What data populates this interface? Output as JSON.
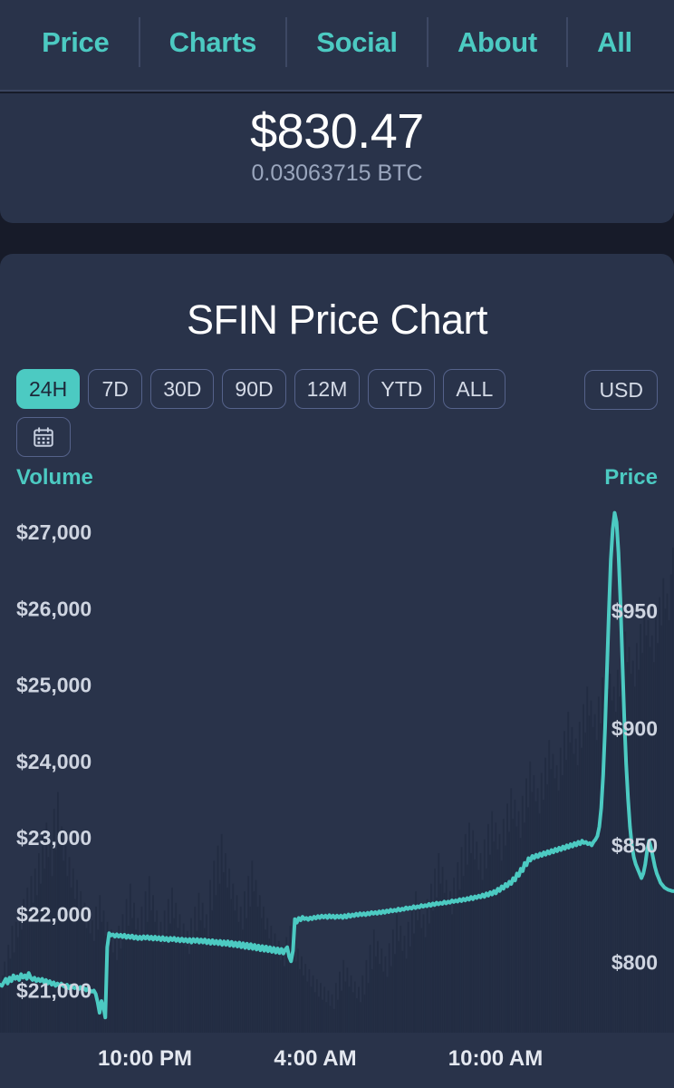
{
  "nav": {
    "items": [
      {
        "label": "Price"
      },
      {
        "label": "Charts"
      },
      {
        "label": "Social"
      },
      {
        "label": "About"
      },
      {
        "label": "All"
      }
    ],
    "accent_color": "#4ccac2"
  },
  "price_header": {
    "price": "$830.47",
    "btc_value": "0.03063715 BTC"
  },
  "chart_card": {
    "title": "SFIN Price Chart",
    "ranges": [
      {
        "label": "24H",
        "active": true
      },
      {
        "label": "7D",
        "active": false
      },
      {
        "label": "30D",
        "active": false
      },
      {
        "label": "90D",
        "active": false
      },
      {
        "label": "12M",
        "active": false
      },
      {
        "label": "YTD",
        "active": false
      },
      {
        "label": "ALL",
        "active": false
      }
    ],
    "calendar_icon": "calendar-icon",
    "currency": "USD",
    "left_axis_title": "Volume",
    "right_axis_title": "Price"
  },
  "chart_data": {
    "type": "line",
    "title": "SFIN Price Chart",
    "xlabel": "",
    "ylabel": "Price",
    "grid": false,
    "legend": "none",
    "line_color": "#4ccac2",
    "volume_color": "#222c42",
    "background_color": "#29334a",
    "x_tick_labels": [
      "10:00 PM",
      "4:00 AM",
      "10:00 AM"
    ],
    "x_tick_positions": [
      0.215,
      0.468,
      0.735
    ],
    "left_axis": {
      "name": "Volume",
      "tick_labels": [
        "$27,000",
        "$26,000",
        "$25,000",
        "$24,000",
        "$23,000",
        "$22,000",
        "$21,000"
      ],
      "tick_values": [
        27000,
        26000,
        25000,
        24000,
        23000,
        22000,
        21000
      ],
      "range": [
        20450,
        27500
      ]
    },
    "right_axis": {
      "name": "Price",
      "tick_labels": [
        "$950",
        "$900",
        "$850",
        "$800"
      ],
      "tick_values": [
        950,
        900,
        850,
        800
      ],
      "range": [
        770,
        1000
      ]
    },
    "series": [
      {
        "name": "Price",
        "axis": "right",
        "unit": "USD",
        "values": [
          790.5,
          790.0,
          791.5,
          793.0,
          791.0,
          793.5,
          792.0,
          794.5,
          793.0,
          794.0,
          792.5,
          795.0,
          793.5,
          794.5,
          793.0,
          795.5,
          793.5,
          792.5,
          793.5,
          792.0,
          793.0,
          792.0,
          793.0,
          791.5,
          792.5,
          791.0,
          792.0,
          790.5,
          791.5,
          790.0,
          791.0,
          790.0,
          791.0,
          790.0,
          789.5,
          790.5,
          789.0,
          790.0,
          789.5,
          789.0,
          789.5,
          788.5,
          789.5,
          788.5,
          789.0,
          788.0,
          789.0,
          788.0,
          787.5,
          788.0,
          786.5,
          783.0,
          778.5,
          783.5,
          781.0,
          776.5,
          806.5,
          812.5,
          811.5,
          812.0,
          811.0,
          812.0,
          811.0,
          811.8,
          810.8,
          811.8,
          810.5,
          811.5,
          810.5,
          811.5,
          810.2,
          811.2,
          810.0,
          811.0,
          810.0,
          811.2,
          810.2,
          811.2,
          810.0,
          811.0,
          809.8,
          811.0,
          809.8,
          810.8,
          809.5,
          810.8,
          809.5,
          810.5,
          809.2,
          810.5,
          809.5,
          810.5,
          809.2,
          810.2,
          809.0,
          810.2,
          809.0,
          810.0,
          808.8,
          810.0,
          808.5,
          810.0,
          808.8,
          810.0,
          808.5,
          809.8,
          808.5,
          809.8,
          808.2,
          809.5,
          808.0,
          809.5,
          808.0,
          809.2,
          807.8,
          809.2,
          807.5,
          809.0,
          807.5,
          809.0,
          807.2,
          808.8,
          807.0,
          808.5,
          806.8,
          808.5,
          806.5,
          808.2,
          806.2,
          808.0,
          806.0,
          807.8,
          805.8,
          807.5,
          805.5,
          807.2,
          805.2,
          807.0,
          805.0,
          806.8,
          804.8,
          806.5,
          804.5,
          806.2,
          804.2,
          806.0,
          804.0,
          805.8,
          803.8,
          805.5,
          806.5,
          802.5,
          800.5,
          805.0,
          818.5,
          817.0,
          819.0,
          818.0,
          819.5,
          818.5,
          819.0,
          818.2,
          819.2,
          818.5,
          819.5,
          818.8,
          819.8,
          819.0,
          820.0,
          819.2,
          820.0,
          819.0,
          820.2,
          819.2,
          820.0,
          819.0,
          820.0,
          819.2,
          820.0,
          819.0,
          820.2,
          819.2,
          820.5,
          819.5,
          820.5,
          819.8,
          820.8,
          820.0,
          821.0,
          820.2,
          821.0,
          820.2,
          821.2,
          820.5,
          821.5,
          820.8,
          821.5,
          820.8,
          821.8,
          821.0,
          822.0,
          821.2,
          822.2,
          821.5,
          822.5,
          821.8,
          822.5,
          822.0,
          823.0,
          822.2,
          823.0,
          822.5,
          823.5,
          822.8,
          823.5,
          823.0,
          824.0,
          823.2,
          824.0,
          823.5,
          824.5,
          823.8,
          824.5,
          824.0,
          825.0,
          824.2,
          825.2,
          824.5,
          825.5,
          824.8,
          825.5,
          825.0,
          826.0,
          825.2,
          826.0,
          825.5,
          826.5,
          825.8,
          826.5,
          826.0,
          827.0,
          826.2,
          827.2,
          826.5,
          827.5,
          826.8,
          828.0,
          827.0,
          828.2,
          827.5,
          828.5,
          827.8,
          829.0,
          828.0,
          829.5,
          828.5,
          830.0,
          829.0,
          830.5,
          829.5,
          831.5,
          830.5,
          832.5,
          831.5,
          833.5,
          832.5,
          834.5,
          833.5,
          836.0,
          835.0,
          838.0,
          837.0,
          840.0,
          839.0,
          842.5,
          841.5,
          844.5,
          843.5,
          845.5,
          844.5,
          846.0,
          845.0,
          846.5,
          845.5,
          847.0,
          846.0,
          847.5,
          846.5,
          848.0,
          847.0,
          848.5,
          847.5,
          849.0,
          848.0,
          849.5,
          848.5,
          850.0,
          849.0,
          850.5,
          849.5,
          851.0,
          850.0,
          851.5,
          850.5,
          852.0,
          851.0,
          851.5,
          850.5,
          851.0,
          850.0,
          851.5,
          852.5,
          854.0,
          858.0,
          866.0,
          880.0,
          900.0,
          925.0,
          950.0,
          972.0,
          985.0,
          992.0,
          988.0,
          975.0,
          955.0,
          930.0,
          905.0,
          885.0,
          870.0,
          858.0,
          850.0,
          845.0,
          842.0,
          840.0,
          838.0,
          836.0,
          838.0,
          842.0,
          848.0,
          852.0,
          849.0,
          845.0,
          841.0,
          838.0,
          836.0,
          834.0,
          833.0,
          832.0,
          831.5,
          831.0,
          830.8,
          830.5,
          830.47
        ]
      },
      {
        "name": "Volume",
        "axis": "left",
        "unit": "USD",
        "values": [
          21050,
          21200,
          21380,
          21150,
          21600,
          21420,
          21850,
          21500,
          21900,
          21700,
          22000,
          21800,
          22200,
          21950,
          22350,
          22050,
          22500,
          22150,
          22600,
          22250,
          22800,
          22400,
          23050,
          22600,
          23200,
          22750,
          22980,
          22500,
          23380,
          22850,
          23600,
          23000,
          23150,
          22700,
          22900,
          22500,
          22750,
          22350,
          22600,
          22200,
          22450,
          22050,
          22300,
          21950,
          22150,
          21820,
          22000,
          21750,
          21920,
          21650,
          22100,
          21800,
          22250,
          21900,
          22050,
          21720,
          21900,
          21600,
          21800,
          21500,
          21700,
          21400,
          21850,
          21550,
          22000,
          21700,
          22200,
          21850,
          22400,
          21950,
          22150,
          21800,
          21950,
          21650,
          22100,
          21750,
          22300,
          21900,
          22500,
          22050,
          22250,
          21900,
          22050,
          21700,
          21900,
          21600,
          22050,
          21750,
          22200,
          21880,
          22350,
          21950,
          22150,
          21820,
          22000,
          21700,
          21880,
          21580,
          21780,
          21480,
          21950,
          21650,
          22100,
          21780,
          22280,
          21920,
          22150,
          21820,
          22000,
          21700,
          22450,
          22050,
          22700,
          22250,
          22900,
          22400,
          23050,
          22550,
          22800,
          22350,
          22600,
          22200,
          22400,
          22050,
          22250,
          21900,
          22100,
          21800,
          22300,
          21950,
          22500,
          22100,
          22700,
          22300,
          22450,
          22100,
          22250,
          21950,
          22100,
          21800,
          21950,
          21680,
          21850,
          21580,
          21750,
          21480,
          21650,
          21400,
          21580,
          21320,
          21700,
          21420,
          21850,
          21520,
          21650,
          21380,
          21550,
          21280,
          21450,
          21200,
          21350,
          21120,
          21280,
          21050,
          21200,
          20980,
          21150,
          20920,
          21100,
          20880,
          21050,
          20850,
          21000,
          20800,
          20950,
          20760,
          21100,
          20880,
          21250,
          21000,
          21400,
          21120,
          21300,
          21050,
          21200,
          20980,
          21120,
          20900,
          21050,
          20850,
          21200,
          20950,
          21400,
          21100,
          21600,
          21280,
          21800,
          21450,
          21650,
          21350,
          21550,
          21250,
          21450,
          21180,
          21620,
          21320,
          21800,
          21480,
          22000,
          21650,
          21850,
          21520,
          21720,
          21420,
          21900,
          21580,
          22100,
          21750,
          22300,
          21920,
          22150,
          21820,
          22000,
          21700,
          22200,
          21880,
          22400,
          22050,
          22600,
          22220,
          22800,
          22400,
          22620,
          22280,
          22450,
          22120,
          22300,
          22000,
          22480,
          22150,
          22680,
          22320,
          22880,
          22500,
          23050,
          22650,
          23200,
          22800,
          23100,
          22720,
          22950,
          22580,
          22800,
          22450,
          22980,
          22600,
          23180,
          22780,
          23350,
          22950,
          23200,
          22850,
          23050,
          22700,
          23250,
          22900,
          23450,
          23080,
          23650,
          23250,
          23500,
          23150,
          23350,
          23000,
          23550,
          23200,
          23780,
          23400,
          24000,
          23600,
          23820,
          23480,
          23650,
          23320,
          23850,
          23500,
          24050,
          23700,
          24280,
          23900,
          24100,
          23780,
          23950,
          23620,
          24180,
          23820,
          24400,
          24020,
          24650,
          24250,
          24450,
          24100,
          24300,
          23950,
          24520,
          24180,
          24750,
          24380,
          24980,
          24600,
          24800,
          24450,
          24620,
          24280,
          24850,
          24500,
          25100,
          24720,
          25350,
          24950,
          25150,
          24800,
          24980,
          24650,
          25200,
          24850,
          25450,
          25080,
          25700,
          25300,
          25500,
          25150,
          25320,
          24980,
          25550,
          25200,
          25800,
          25420,
          26050,
          25650,
          25850,
          25500,
          25650,
          25300,
          25900,
          25550,
          26150,
          25780,
          26400,
          26000,
          26200,
          25850,
          26450,
          26800
        ]
      }
    ]
  }
}
